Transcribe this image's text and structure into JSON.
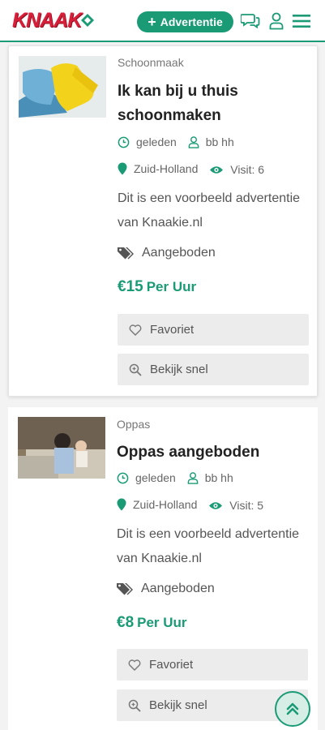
{
  "header": {
    "logo_text": "KNAAK",
    "add_button_label": "Advertentie",
    "brand_color": "#1a9b75",
    "logo_color": "#d81f3a"
  },
  "icons": {
    "chat": "chat-icon",
    "user": "user-icon",
    "menu": "hamburger-icon",
    "clock": "clock-icon",
    "person": "person-icon",
    "location": "map-pin-icon",
    "eye": "eye-icon",
    "tags": "tags-icon",
    "heart": "heart-icon",
    "zoom": "zoom-icon",
    "scroll_top": "double-chevron-up-icon"
  },
  "listings": [
    {
      "category": "Schoonmaak",
      "title": "Ik kan bij u thuis schoonmaken",
      "time": "geleden",
      "user": "bb hh",
      "location": "Zuid-Holland",
      "visits": "Visit: 6",
      "description": "Dit is een voorbeeld advertentie van Knaakie.nl",
      "type": "Aangeboden",
      "price": "€15",
      "price_unit": "Per Uur",
      "favorite_label": "Favoriet",
      "quickview_label": "Bekijk snel"
    },
    {
      "category": "Oppas",
      "title": "Oppas aangeboden",
      "time": "geleden",
      "user": "bb hh",
      "location": "Zuid-Holland",
      "visits": "Visit: 5",
      "description": "Dit is een voorbeeld advertentie van Knaakie.nl",
      "type": "Aangeboden",
      "price": "€8",
      "price_unit": "Per Uur",
      "favorite_label": "Favoriet",
      "quickview_label": "Bekijk snel"
    }
  ]
}
